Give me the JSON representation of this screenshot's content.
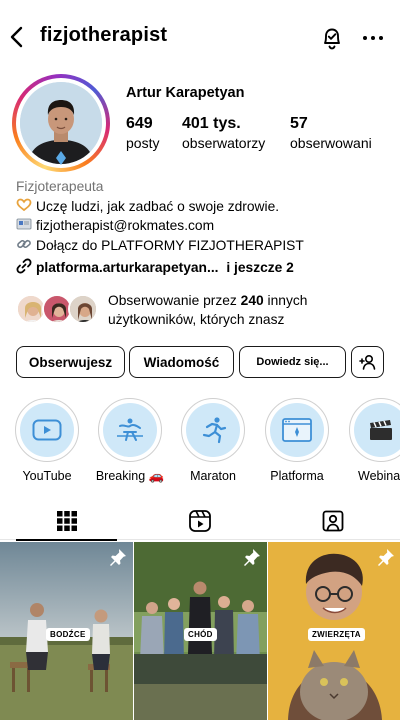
{
  "header": {
    "username": "fizjotherapist"
  },
  "profile": {
    "full_name": "Artur Karapetyan",
    "stats": [
      {
        "value": "649",
        "label": "posty"
      },
      {
        "value": "401 tys.",
        "label": "obserwatorzy"
      },
      {
        "value": "57",
        "label": "obserwowani"
      }
    ]
  },
  "bio": {
    "category": "Fizjoterapeuta",
    "line1": "Uczę ludzi, jak zadbać o swoje zdrowie.",
    "line2": "fizjotherapist@rokmates.com",
    "line3": "Dołącz do PLATFORMY FIZJOTHERAPIST",
    "link": "platforma.arturkarapetyan...",
    "link_more": "i jeszcze 2"
  },
  "followed_by": {
    "line1_pre": "Obserwowanie przez ",
    "count": "240",
    "line1_post": " innych",
    "line2": "użytkowników, których znasz"
  },
  "buttons": {
    "following": "Obserwujesz",
    "message": "Wiadomość",
    "learn_more": "Dowiedz się..."
  },
  "highlights": [
    {
      "label": "YouTube",
      "icon": "youtube-icon"
    },
    {
      "label": "Breaking 🚗",
      "icon": "breaking-figure-icon"
    },
    {
      "label": "Maraton",
      "icon": "runner-icon"
    },
    {
      "label": "Platforma",
      "icon": "browser-window-icon"
    },
    {
      "label": "Webina",
      "icon": "clapperboard-icon"
    }
  ],
  "tabs": [
    {
      "name": "posts",
      "icon": "grid-icon",
      "active": true
    },
    {
      "name": "reels",
      "icon": "reels-icon",
      "active": false
    },
    {
      "name": "tagged",
      "icon": "tagged-user-icon",
      "active": false
    }
  ],
  "posts": [
    {
      "tag": "BODŹCE",
      "pinned": true
    },
    {
      "tag": "CHÓD",
      "pinned": true
    },
    {
      "tag": "ZWIERZĘTA",
      "pinned": true
    }
  ],
  "colors": {
    "story_ring": [
      "#feda75",
      "#fa7e1e",
      "#d62976",
      "#962fbf",
      "#4f5bd5"
    ],
    "highlight_fill": "#cfe8f8",
    "category_text": "#737373"
  }
}
